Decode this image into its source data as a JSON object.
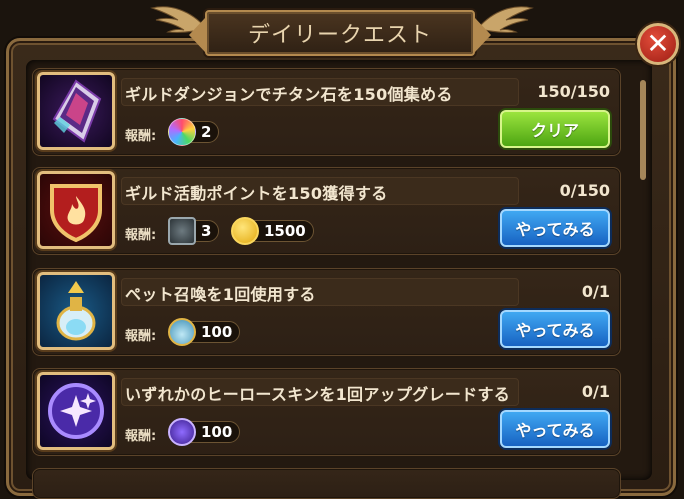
{
  "header": {
    "title": "デイリークエスト"
  },
  "reward_label": "報酬:",
  "quests": [
    {
      "title": "ギルドダンジョンでチタン石を150個集める",
      "progress": "150/150",
      "rewards": [
        {
          "icon": "rainbow-gem-icon",
          "amount": "2"
        }
      ],
      "button": "クリア",
      "button_state": "clear"
    },
    {
      "title": "ギルド活動ポイントを150獲得する",
      "progress": "0/150",
      "rewards": [
        {
          "icon": "stone-item-icon",
          "amount": "3"
        },
        {
          "icon": "gold-coin-icon",
          "amount": "1500"
        }
      ],
      "button": "やってみる",
      "button_state": "try"
    },
    {
      "title": "ペット召喚を1回使用する",
      "progress": "0/1",
      "rewards": [
        {
          "icon": "potion-bottle-icon",
          "amount": "100"
        }
      ],
      "button": "やってみる",
      "button_state": "try"
    },
    {
      "title": "いずれかのヒーロースキンを1回アップグレードする",
      "progress": "0/1",
      "rewards": [
        {
          "icon": "purple-star-orb-icon",
          "amount": "100"
        }
      ],
      "button": "やってみる",
      "button_state": "try"
    }
  ],
  "colors": {
    "frame_gold": "#b48a4f",
    "clear_green": "#4da512",
    "try_blue": "#1762c2",
    "close_red": "#c33524"
  }
}
